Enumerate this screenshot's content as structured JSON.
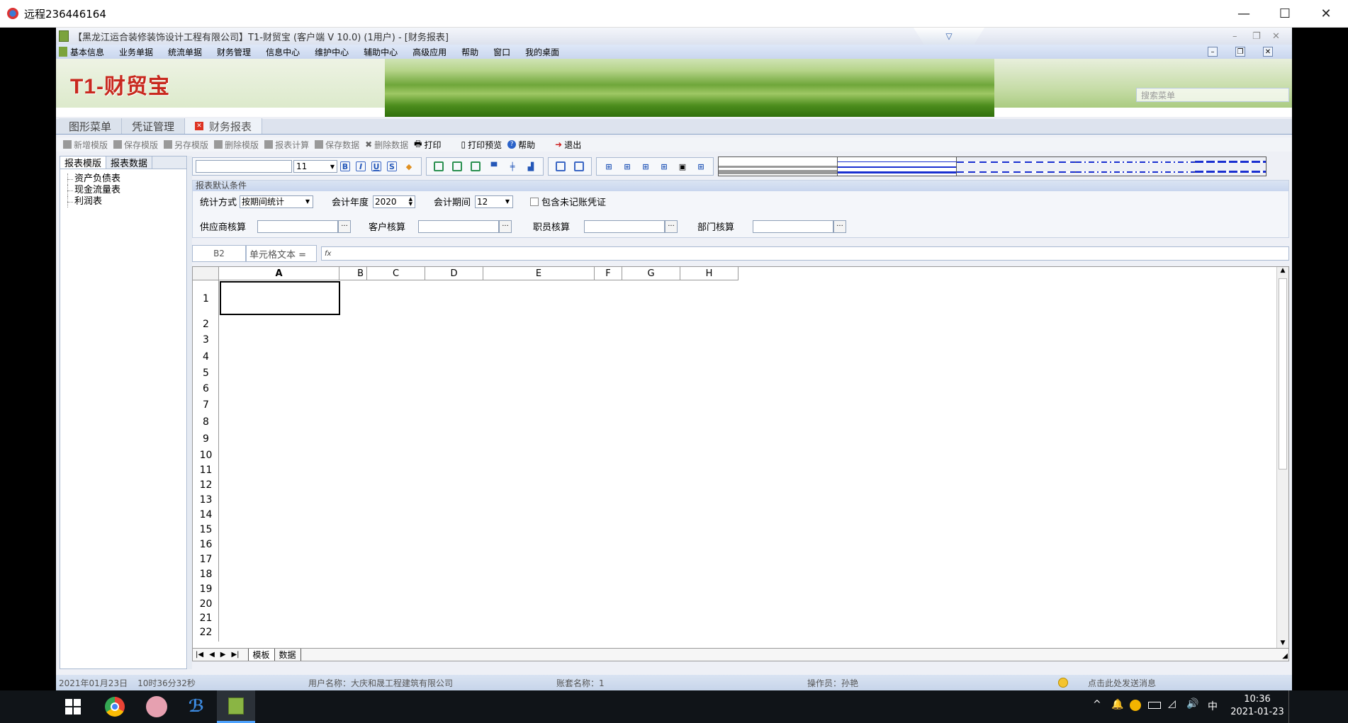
{
  "outer_window": {
    "title": "远程236446164",
    "minimize": "—",
    "maximize": "☐",
    "close": "✕"
  },
  "app": {
    "title": "【黑龙江运合装修装饰设计工程有限公司】T1-财贸宝 (客户端 V 10.0) (1用户) - [财务报表]",
    "logo_text": "T1-财贸宝",
    "search_placeholder": "搜索菜单",
    "window_icons": {
      "minimize": "–",
      "restore": "❐",
      "close": "✕"
    }
  },
  "menu": [
    "基本信息",
    "业务单据",
    "统流单据",
    "财务管理",
    "信息中心",
    "维护中心",
    "辅助中心",
    "高级应用",
    "帮助",
    "窗口",
    "我的桌面"
  ],
  "tabs": [
    {
      "label": "图形菜单",
      "active": false
    },
    {
      "label": "凭证管理",
      "active": false
    },
    {
      "label": "财务报表",
      "active": true
    }
  ],
  "toolbar": [
    "新增模版",
    "保存模版",
    "另存模版",
    "删除模版",
    "报表计算",
    "保存数据",
    "删除数据",
    "打印",
    "打印预览",
    "帮助",
    "退出"
  ],
  "left_panel": {
    "tabs": [
      "报表模版",
      "报表数据"
    ],
    "tree": [
      "资产负债表",
      "现金流量表",
      "利润表"
    ]
  },
  "format_bar": {
    "font_name": "",
    "font_size": "11",
    "buttons": [
      "B",
      "I",
      "U",
      "S"
    ]
  },
  "conditions": {
    "header": "报表默认条件",
    "stat_method_label": "统计方式",
    "stat_method_value": "按期间统计",
    "year_label": "会计年度",
    "year_value": "2020",
    "period_label": "会计期间",
    "period_value": "12",
    "unposted_label": "包含未记账凭证",
    "supplier_label": "供应商核算",
    "customer_label": "客户核算",
    "employee_label": "职员核算",
    "dept_label": "部门核算"
  },
  "formula_bar": {
    "cell_ref": "B2",
    "mode": "单元格文本 =",
    "fx": "fx"
  },
  "sheet": {
    "columns": [
      "A",
      "B",
      "C",
      "D",
      "E",
      "F",
      "G",
      "H"
    ],
    "rows": [
      "1",
      "2",
      "3",
      "4",
      "5",
      "6",
      "7",
      "8",
      "9",
      "10",
      "11",
      "12",
      "13",
      "14",
      "15",
      "16",
      "17",
      "18",
      "19",
      "20",
      "21",
      "22"
    ],
    "sheet_tabs": [
      "模板",
      "数据"
    ],
    "nav": [
      "|◀",
      "◀",
      "▶",
      "▶|"
    ]
  },
  "status": {
    "date": "2021年01月23日",
    "time": "10时36分32秒",
    "user": "用户名称：大庆和晟工程建筑有限公司",
    "account": "账套名称：1",
    "operator": "操作员：孙艳",
    "message": "点击此处发送消息"
  },
  "taskbar": {
    "time": "10:36",
    "date": "2021-01-23",
    "ime": "中"
  }
}
